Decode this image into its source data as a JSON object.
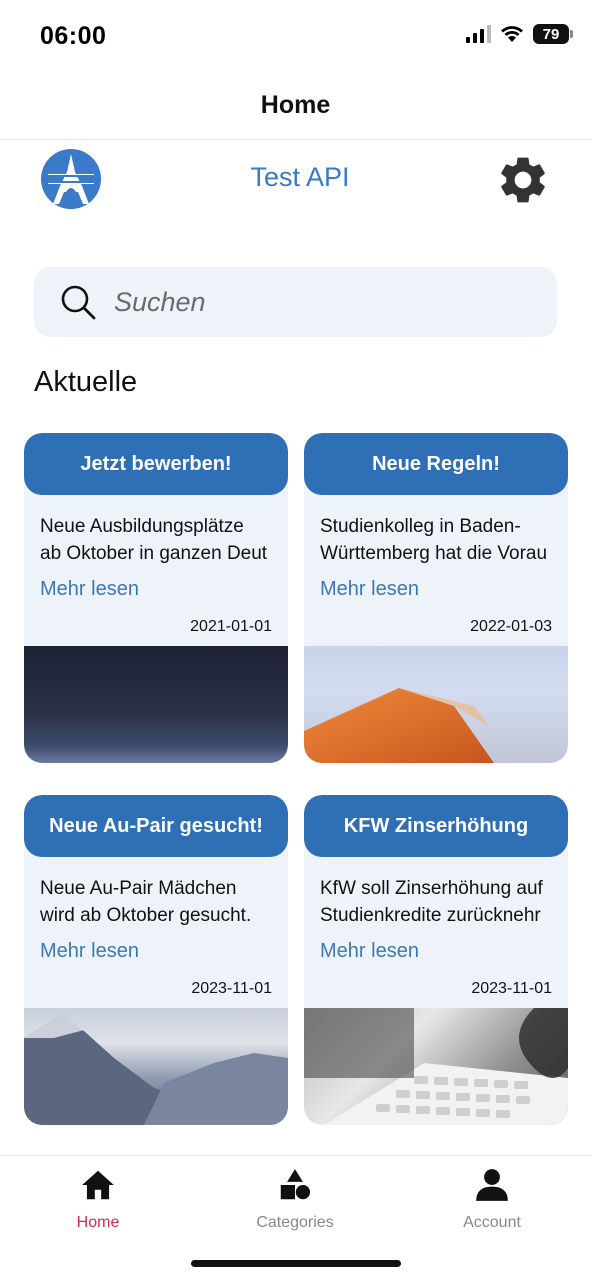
{
  "status_bar": {
    "time": "06:00",
    "battery": "79"
  },
  "header": {
    "title": "Home"
  },
  "top_bar": {
    "app_title": "Test API",
    "logo_icon": "eiffel-tower-logo-icon",
    "settings_icon": "gear-icon"
  },
  "search": {
    "placeholder": "Suchen",
    "icon": "search-icon"
  },
  "section": {
    "title": "Aktuelle"
  },
  "cards": [
    {
      "title": "Jetzt bewerben!",
      "desc_line1": "Neue Ausbildungsplätze",
      "desc_line2": "ab Oktober in ganzen Deut",
      "link": "Mehr lesen",
      "date": "2021-01-01"
    },
    {
      "title": "Neue Regeln!",
      "desc_line1": "Studienkolleg in Baden-",
      "desc_line2": "Württemberg hat die Vorau",
      "link": "Mehr lesen",
      "date": "2022-01-03"
    },
    {
      "title": "Neue Au-Pair gesucht!",
      "desc_line1": "Neue Au-Pair Mädchen",
      "desc_line2": "wird ab Oktober gesucht.",
      "link": "Mehr lesen",
      "date": "2023-11-01"
    },
    {
      "title": "KFW Zinserhöhung",
      "desc_line1": "KfW soll Zinserhöhung auf",
      "desc_line2": "Studienkredite zurücknehr",
      "link": "Mehr lesen",
      "date": "2023-11-01"
    }
  ],
  "tabs": [
    {
      "label": "Home",
      "icon": "home-icon",
      "active": true
    },
    {
      "label": "Categories",
      "icon": "shapes-icon",
      "active": false
    },
    {
      "label": "Account",
      "icon": "user-icon",
      "active": false
    }
  ],
  "colors": {
    "accent": "#2f6fb6",
    "link": "#3b78b4",
    "active_tab": "#d1285a",
    "card_bg": "#eef3fa"
  }
}
